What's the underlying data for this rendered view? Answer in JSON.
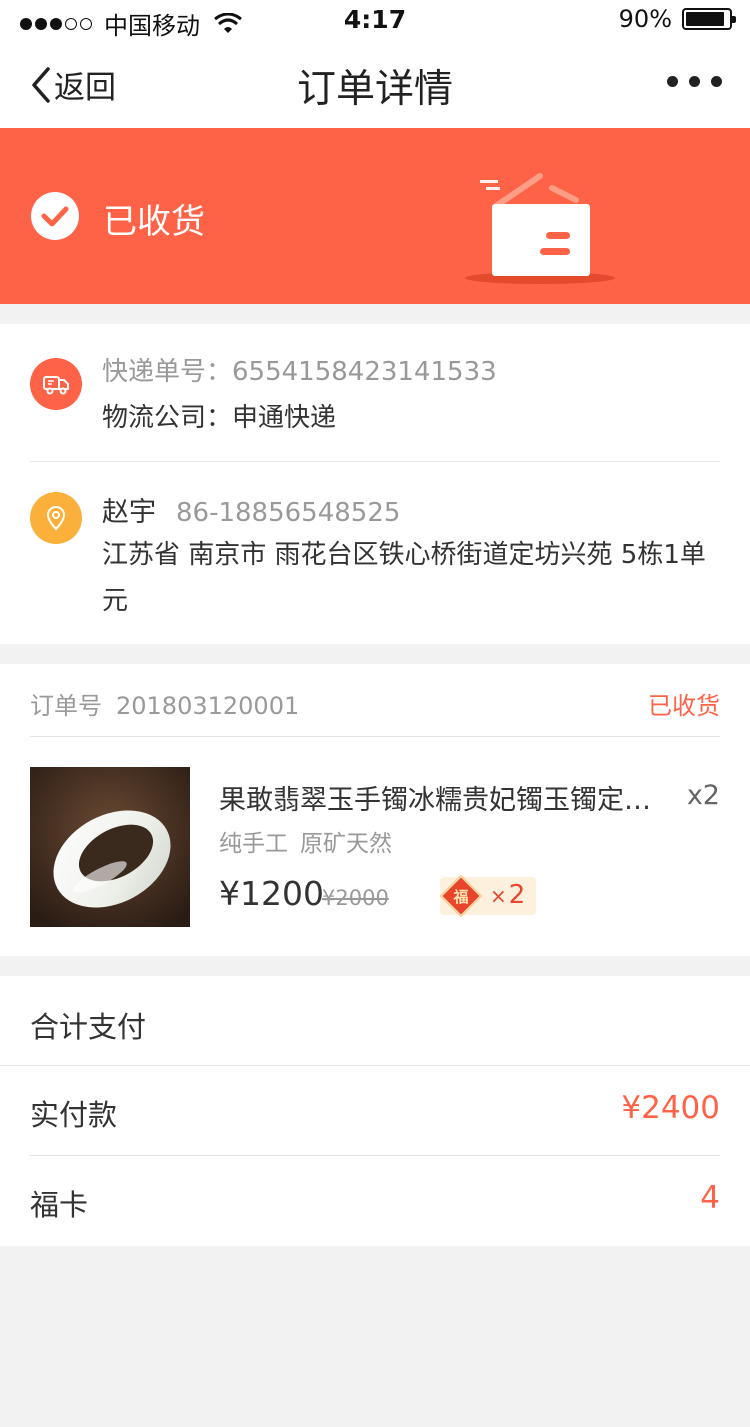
{
  "status_bar": {
    "carrier": "中国移动",
    "time": "4:17",
    "battery": "90%"
  },
  "nav": {
    "back_label": "返回",
    "title": "订单详情"
  },
  "banner": {
    "status_text": "已收货",
    "color": "#ff6347"
  },
  "logistics": {
    "tracking_label": "快递单号：",
    "tracking_number": "6554158423141533",
    "company_label": "物流公司：",
    "company": "申通快递"
  },
  "address": {
    "name": "赵宇",
    "phone": "86-18856548525",
    "address_line": "江苏省  南京市 雨花台区铁心桥街道定坊兴苑 5栋1单元"
  },
  "order": {
    "number_label": "订单号",
    "number": "201803120001",
    "status": "已收货",
    "product": {
      "title": "果敢翡翠玉手镯冰糯贵妃镯玉镯定制款",
      "quantity": "x2",
      "tags": [
        "纯手工",
        "原矿天然"
      ],
      "price": "¥1200",
      "original_price": "¥2000",
      "fu_card_char": "福",
      "fu_card_x": "×",
      "fu_card_count": "2"
    }
  },
  "summary": {
    "title": "合计支付",
    "rows": [
      {
        "label": "实付款",
        "value": "¥2400"
      },
      {
        "label": "福卡",
        "value": "4"
      }
    ]
  },
  "colors": {
    "accent": "#ff6347",
    "pin": "#fbb03b",
    "background": "#f2f2f2"
  }
}
